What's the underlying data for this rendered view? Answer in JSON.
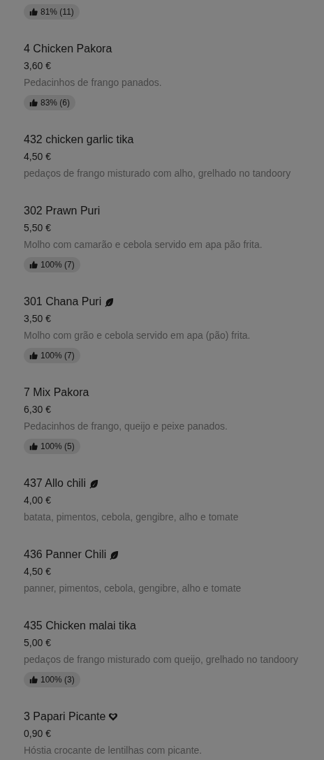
{
  "items": [
    {
      "rating": "81% (11)"
    },
    {
      "name": "4 Chicken Pakora",
      "price": "3,60 €",
      "description": "Pedacinhos de frango panados.",
      "rating": "83% (6)"
    },
    {
      "name": "432 chicken garlic tika",
      "price": "4,50 €",
      "description": "pedaços de frango misturado com alho, grelhado no tandoory"
    },
    {
      "name": "302 Prawn Puri",
      "price": "5,50 €",
      "description": "Molho com camarão e cebola servido em apa pão frita.",
      "rating": "100% (7)"
    },
    {
      "name": "301 Chana Puri",
      "kind": "vegetarian",
      "price": "3,50 €",
      "description": "Molho com grão e cebola servido em apa (pão) frita.",
      "rating": "100% (7)"
    },
    {
      "name": "7 Mix Pakora",
      "price": "6,30 €",
      "description": "Pedacinhos de frango, queijo e peixe panados.",
      "rating": "100% (5)"
    },
    {
      "name": "437 Allo chili",
      "kind": "vegetarian",
      "price": "4,00 €",
      "description": "batata, pimentos, cebola, gengibre, alho e tomate"
    },
    {
      "name": "436 Panner Chili",
      "kind": "vegetarian",
      "price": "4,50 €",
      "description": "panner, pimentos, cebola, gengibre, alho e tomate"
    },
    {
      "name": "435 Chicken malai tika",
      "price": "5,00 €",
      "description": "pedaços de frango misturado com queijo, grelhado no tandoory",
      "rating": "100% (3)"
    },
    {
      "name": "3 Papari Picante",
      "kind": "favourite",
      "price": "0,90 €",
      "description": "Hóstia crocante de lentilhas com picante."
    }
  ]
}
